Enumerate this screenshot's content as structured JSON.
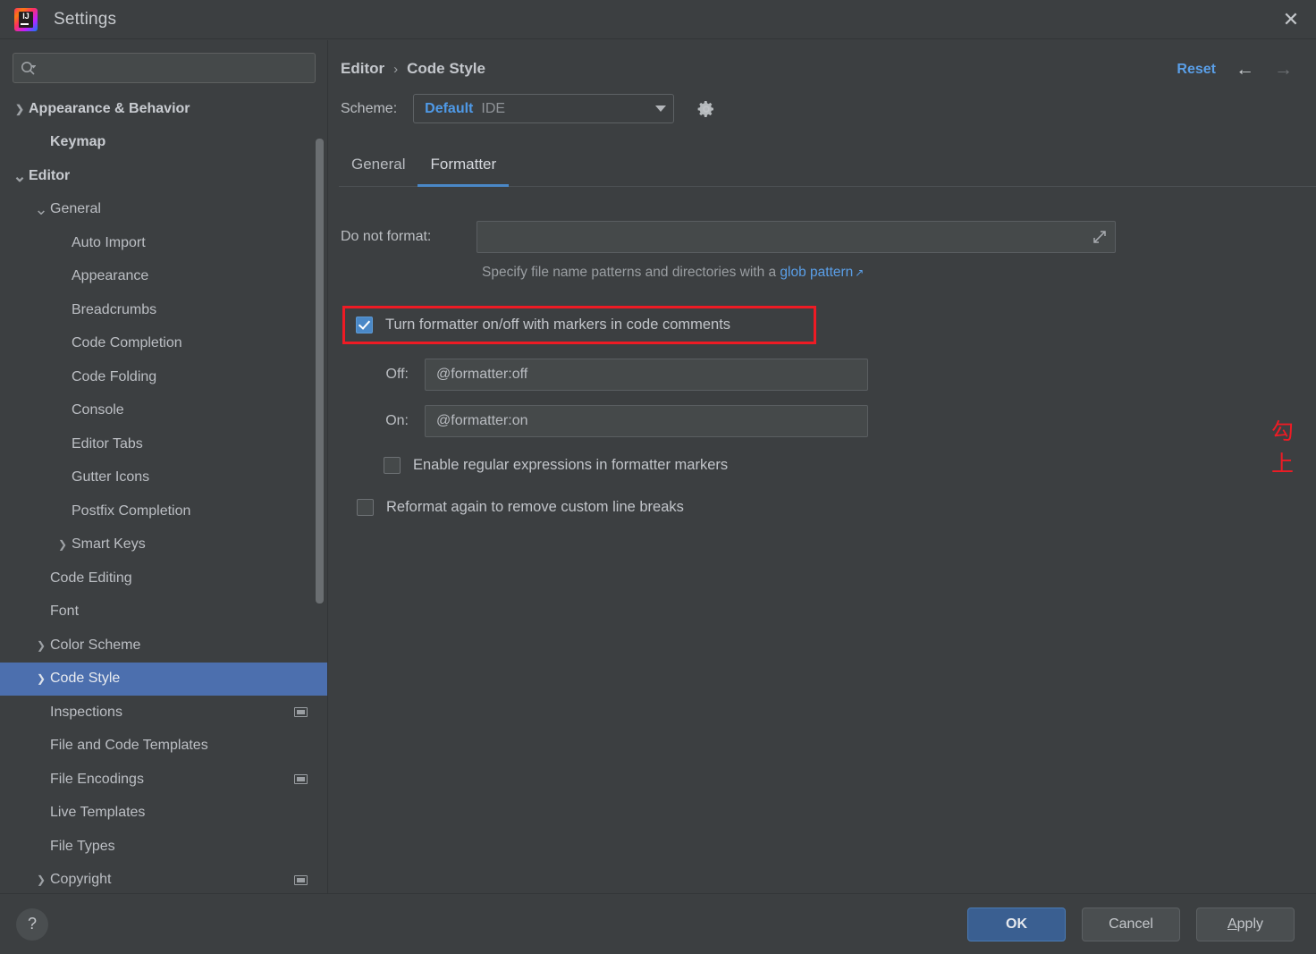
{
  "window": {
    "title": "Settings",
    "logo_icon": "intellij-idea-logo",
    "close_icon": "close-icon",
    "close_label": "✕"
  },
  "sidebar": {
    "search": {
      "placeholder": "",
      "value": "",
      "icon": "search-icon"
    },
    "items": [
      {
        "label": "Appearance & Behavior",
        "indent": 0,
        "chevron": "›",
        "bold": true,
        "selected": false,
        "badge": false
      },
      {
        "label": "Keymap",
        "indent": 1,
        "chevron": "",
        "bold": true,
        "selected": false,
        "badge": false
      },
      {
        "label": "Editor",
        "indent": 0,
        "chevron": "⌄",
        "bold": true,
        "selected": false,
        "badge": false
      },
      {
        "label": "General",
        "indent": 1,
        "chevron": "⌄",
        "bold": false,
        "selected": false,
        "badge": false
      },
      {
        "label": "Auto Import",
        "indent": 2,
        "chevron": "",
        "bold": false,
        "selected": false,
        "badge": false
      },
      {
        "label": "Appearance",
        "indent": 2,
        "chevron": "",
        "bold": false,
        "selected": false,
        "badge": false
      },
      {
        "label": "Breadcrumbs",
        "indent": 2,
        "chevron": "",
        "bold": false,
        "selected": false,
        "badge": false
      },
      {
        "label": "Code Completion",
        "indent": 2,
        "chevron": "",
        "bold": false,
        "selected": false,
        "badge": false
      },
      {
        "label": "Code Folding",
        "indent": 2,
        "chevron": "",
        "bold": false,
        "selected": false,
        "badge": false
      },
      {
        "label": "Console",
        "indent": 2,
        "chevron": "",
        "bold": false,
        "selected": false,
        "badge": false
      },
      {
        "label": "Editor Tabs",
        "indent": 2,
        "chevron": "",
        "bold": false,
        "selected": false,
        "badge": false
      },
      {
        "label": "Gutter Icons",
        "indent": 2,
        "chevron": "",
        "bold": false,
        "selected": false,
        "badge": false
      },
      {
        "label": "Postfix Completion",
        "indent": 2,
        "chevron": "",
        "bold": false,
        "selected": false,
        "badge": false
      },
      {
        "label": "Smart Keys",
        "indent": 2,
        "chevron": "›",
        "bold": false,
        "selected": false,
        "badge": false
      },
      {
        "label": "Code Editing",
        "indent": 1,
        "chevron": "",
        "bold": false,
        "selected": false,
        "badge": false
      },
      {
        "label": "Font",
        "indent": 1,
        "chevron": "",
        "bold": false,
        "selected": false,
        "badge": false
      },
      {
        "label": "Color Scheme",
        "indent": 1,
        "chevron": "›",
        "bold": false,
        "selected": false,
        "badge": false
      },
      {
        "label": "Code Style",
        "indent": 1,
        "chevron": "›",
        "bold": false,
        "selected": true,
        "badge": false
      },
      {
        "label": "Inspections",
        "indent": 1,
        "chevron": "",
        "bold": false,
        "selected": false,
        "badge": true
      },
      {
        "label": "File and Code Templates",
        "indent": 1,
        "chevron": "",
        "bold": false,
        "selected": false,
        "badge": false
      },
      {
        "label": "File Encodings",
        "indent": 1,
        "chevron": "",
        "bold": false,
        "selected": false,
        "badge": true
      },
      {
        "label": "Live Templates",
        "indent": 1,
        "chevron": "",
        "bold": false,
        "selected": false,
        "badge": false
      },
      {
        "label": "File Types",
        "indent": 1,
        "chevron": "",
        "bold": false,
        "selected": false,
        "badge": false
      },
      {
        "label": "Copyright",
        "indent": 1,
        "chevron": "›",
        "bold": false,
        "selected": false,
        "badge": true
      }
    ]
  },
  "header": {
    "breadcrumb": {
      "parent": "Editor",
      "separator": "›",
      "current": "Code Style"
    },
    "reset_label": "Reset",
    "back_icon": "arrow-left-icon",
    "back_glyph": "←",
    "forward_icon": "arrow-right-icon",
    "forward_glyph": "→"
  },
  "scheme": {
    "label": "Scheme:",
    "value": "Default",
    "value_suffix": "IDE",
    "gear_icon": "gear-icon",
    "dropdown_icon": "chevron-down-icon"
  },
  "tabs": [
    {
      "label": "General",
      "active": false
    },
    {
      "label": "Formatter",
      "active": true
    }
  ],
  "form": {
    "do_not_format": {
      "label": "Do not format:",
      "value": "",
      "placeholder": "",
      "expand_icon": "expand-icon"
    },
    "hint": {
      "text": "Specify file name patterns and directories with a ",
      "link": "glob pattern",
      "link_arrow": "↗"
    },
    "markers_checkbox": {
      "label": "Turn formatter on/off with markers in code comments",
      "checked": true
    },
    "off_field": {
      "label": "Off:",
      "value": "@formatter:off"
    },
    "on_field": {
      "label": "On:",
      "value": "@formatter:on"
    },
    "regex_checkbox": {
      "label": "Enable regular expressions in formatter markers",
      "checked": false
    },
    "reformat_checkbox": {
      "label": "Reformat again to remove custom line breaks",
      "checked": false
    }
  },
  "annotation": {
    "text": "勾上",
    "color": "#ee1b24"
  },
  "footer": {
    "help_label": "?",
    "help_icon": "help-icon",
    "ok_label": "OK",
    "cancel_label": "Cancel",
    "apply_mnemonic": "A",
    "apply_rest": "pply"
  },
  "colors": {
    "background": "#3c3f41",
    "selection": "#4c6fae",
    "accent_link": "#5a9fe8",
    "accent_blue": "#4a88c7",
    "annotation_red": "#ee1b24",
    "primary_button": "#3a5f91"
  }
}
